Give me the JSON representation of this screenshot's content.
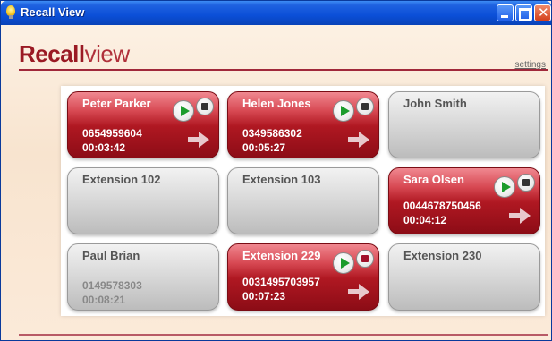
{
  "window": {
    "title": "Recall View"
  },
  "header": {
    "logo_bold": "Recall",
    "logo_light": "view",
    "settings_label": "settings"
  },
  "tiles": [
    {
      "name": "Peter Parker",
      "number": "0654959604",
      "duration": "00:03:42",
      "active": true
    },
    {
      "name": "Helen Jones",
      "number": "0349586302",
      "duration": "00:05:27",
      "active": true
    },
    {
      "name": "John Smith",
      "number": "",
      "duration": "",
      "active": false
    },
    {
      "name": "Extension 102",
      "number": "",
      "duration": "",
      "active": false
    },
    {
      "name": "Extension 103",
      "number": "",
      "duration": "",
      "active": false
    },
    {
      "name": "Sara Olsen",
      "number": "0044678750456",
      "duration": "00:04:12",
      "active": true
    },
    {
      "name": "Paul Brian",
      "number": "0149578303",
      "duration": "00:08:21",
      "active": false
    },
    {
      "name": "Extension 229",
      "number": "0031495703957",
      "duration": "00:07:23",
      "active": true
    },
    {
      "name": "Extension 230",
      "number": "",
      "duration": "",
      "active": false
    }
  ]
}
